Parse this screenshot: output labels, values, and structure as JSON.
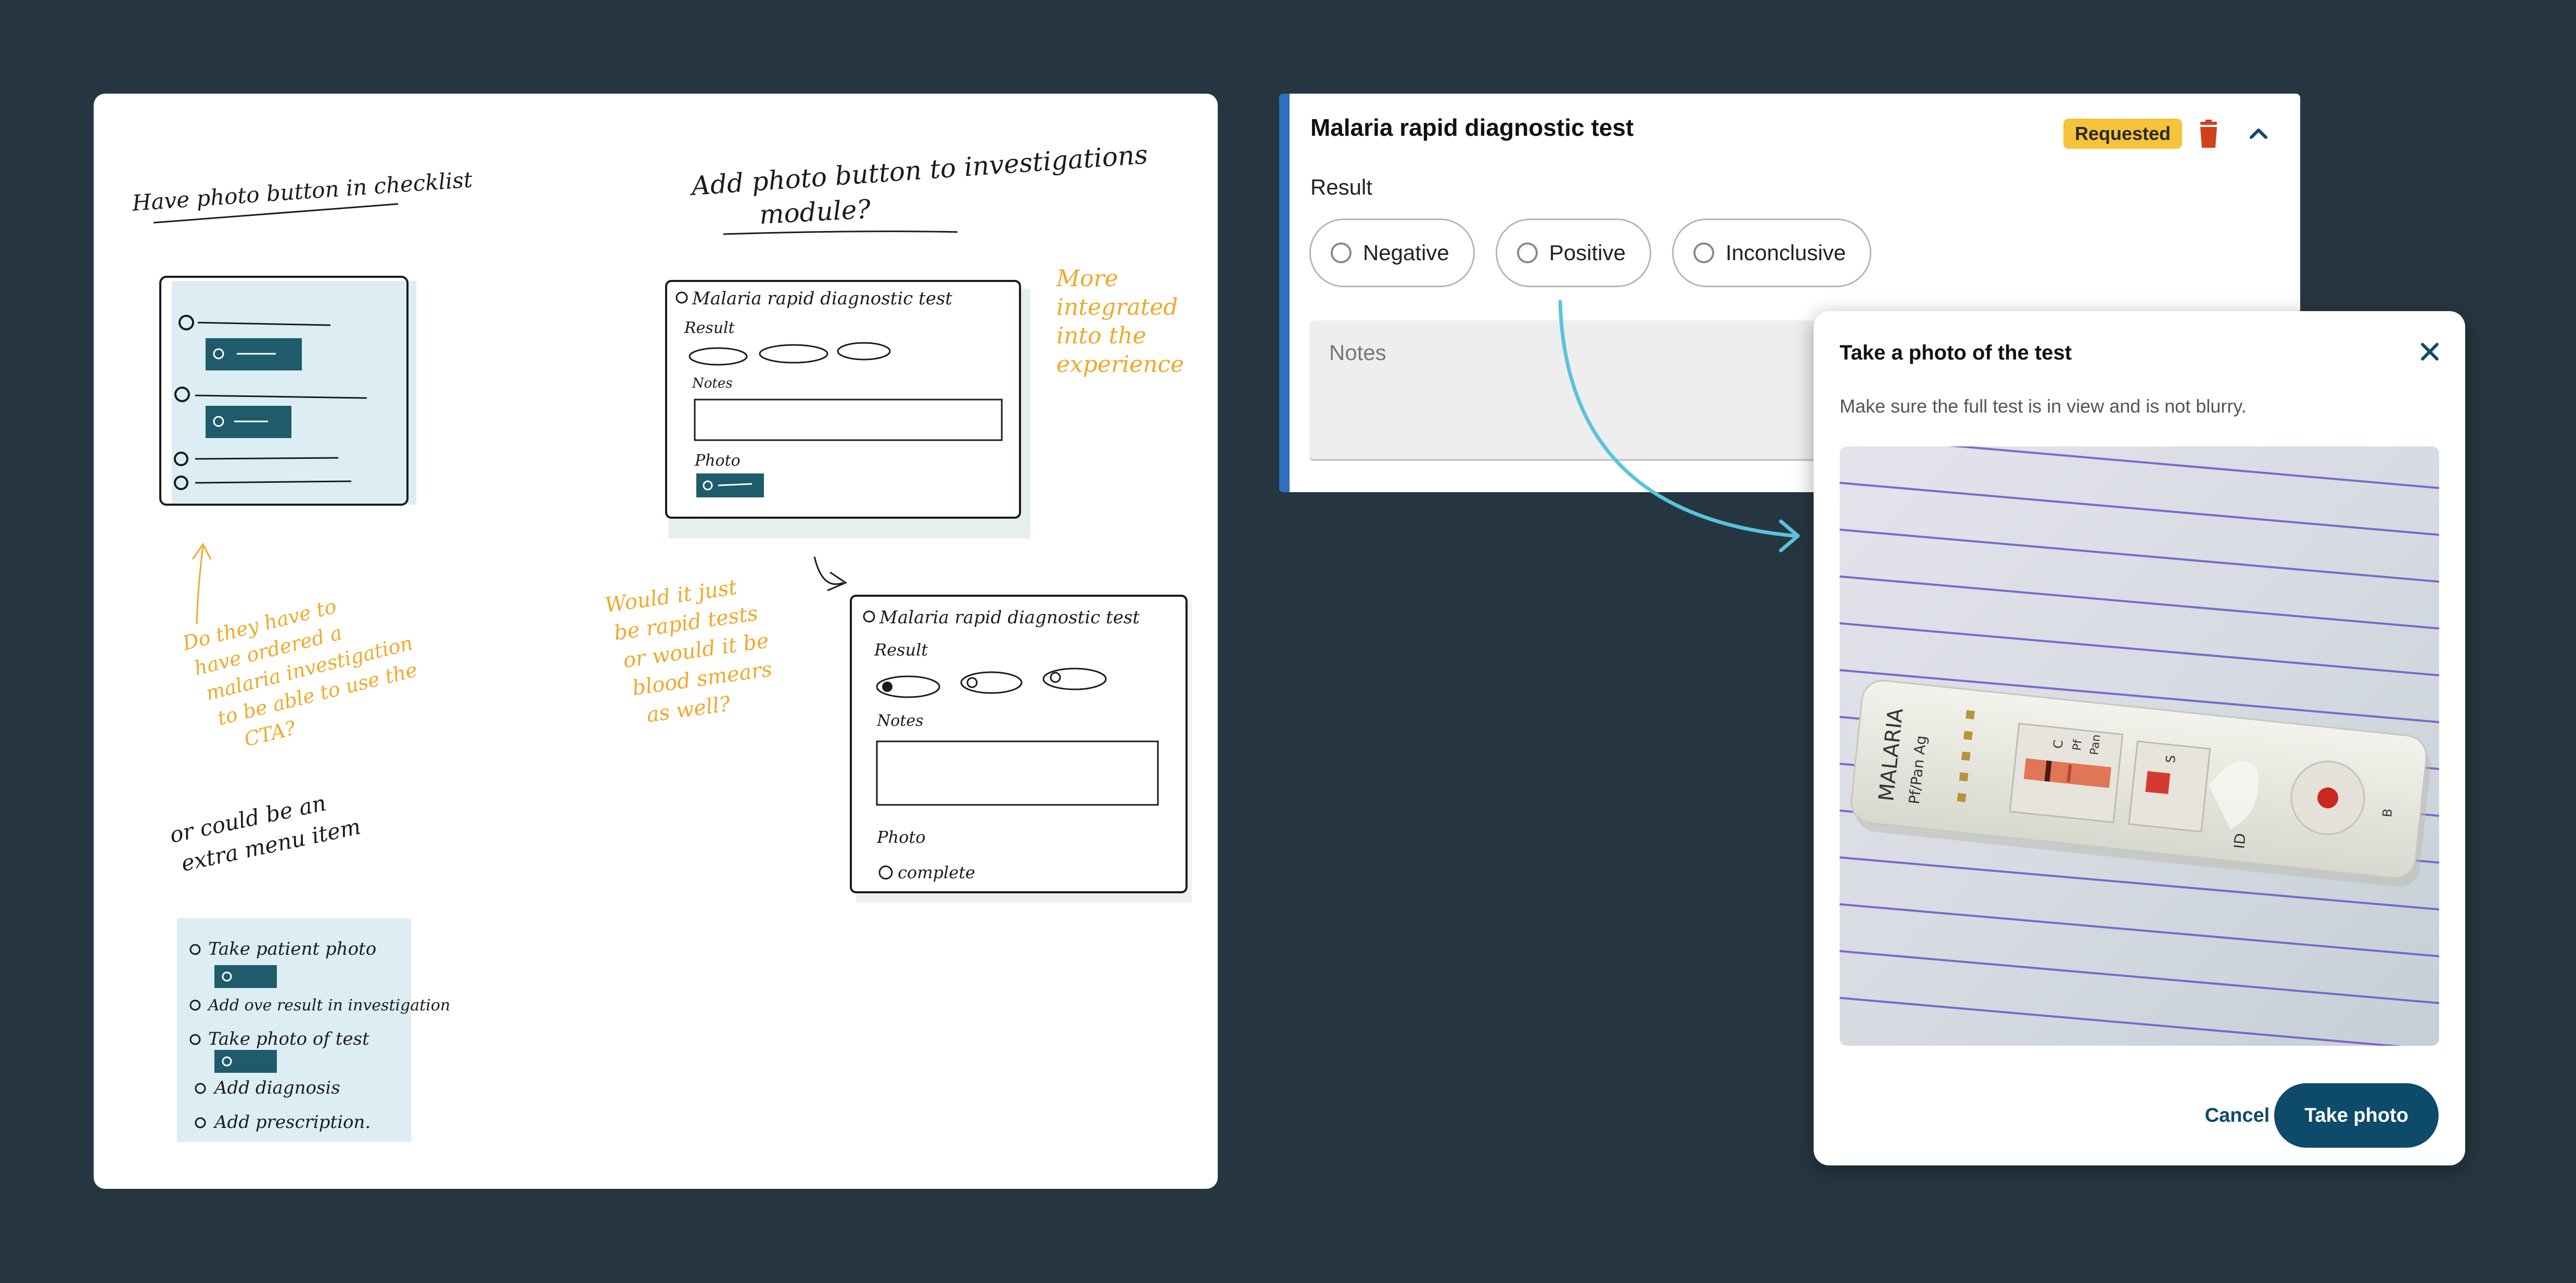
{
  "sketch": {
    "heading_left": "Have photo button in checklist",
    "heading_center_1": "Add photo button to investigations",
    "heading_center_2": "module?",
    "note_integrated": [
      "More",
      "integrated",
      "into the",
      "experience"
    ],
    "note_ordered": [
      "Do they have to",
      "have ordered a",
      "malaria investigation",
      "to be able to use the",
      "CTA?"
    ],
    "note_rapid": [
      "Would it just",
      "be rapid tests",
      "or would it be",
      "blood smears",
      "as well?"
    ],
    "note_menu": [
      "or could be an",
      "extra menu item"
    ],
    "wire_title": "Malaria rapid diagnostic test",
    "wire_result": "Result",
    "wire_notes": "Notes",
    "wire_photo": "Photo",
    "wire_complete": "complete",
    "menu_items": [
      "Take patient photo",
      "Add ove result in investigation",
      "Take photo of test",
      "Add diagnosis",
      "Add prescription."
    ]
  },
  "card": {
    "title": "Malaria rapid diagnostic test",
    "status_badge": "Requested",
    "result_label": "Result",
    "options": [
      "Negative",
      "Positive",
      "Inconclusive"
    ],
    "notes_placeholder": "Notes"
  },
  "modal": {
    "title": "Take a photo of the test",
    "description": "Make sure the full test is in view and is not blurry.",
    "cancel_label": "Cancel",
    "take_photo_label": "Take photo",
    "test_cassette_text": {
      "brand": "MALARIA",
      "subtitle": "Pf/Pan Ag",
      "c": "C",
      "pf": "Pf",
      "pan": "Pan",
      "s": "S",
      "id": "ID",
      "b": "B"
    }
  },
  "colors": {
    "background": "#263641",
    "accent_blue": "#2f6fc2",
    "badge_yellow": "#f5c43a",
    "primary_button": "#0e4a6a",
    "delete_red": "#d0401b",
    "arrow_cyan": "#5bc3dc",
    "sketch_orange": "#f0a92a"
  },
  "icons": [
    "trash-icon",
    "chevron-up-icon",
    "close-icon",
    "camera-icon"
  ]
}
